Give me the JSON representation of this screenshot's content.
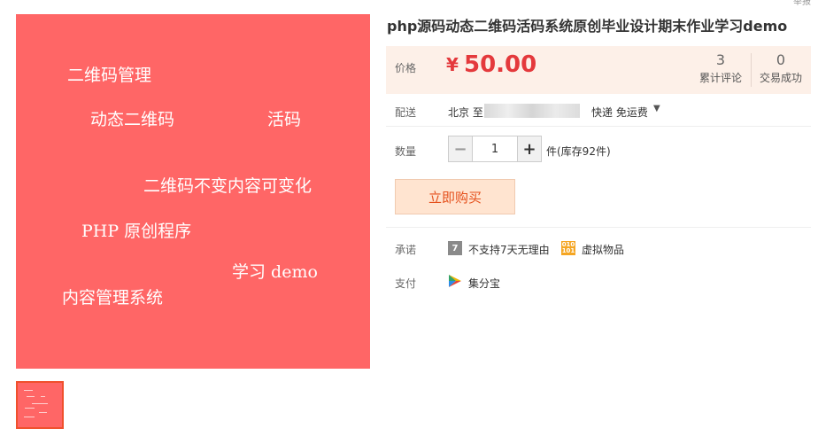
{
  "product": {
    "title": "php源码动态二维码活码系统原创毕业设计期末作业学习demo",
    "image_tags": [
      "二维码管理",
      "动态二维码",
      "活码",
      "二维码不变内容可变化",
      "PHP 原创程序",
      "学习 demo",
      "内容管理系统"
    ],
    "colors": {
      "image_bg": "#ff6666",
      "accent": "#e4393c",
      "buy_text": "#e5511d"
    }
  },
  "price": {
    "label": "价格",
    "currency": "¥",
    "value": "50.00"
  },
  "stats": [
    {
      "num": "3",
      "label": "累计评论"
    },
    {
      "num": "0",
      "label": "交易成功"
    }
  ],
  "shipping": {
    "label": "配送",
    "from": "北京 至",
    "method": "快递 免运费"
  },
  "quantity": {
    "label": "数量",
    "value": "1",
    "stock": "件(库存92件)"
  },
  "buy_button": "立即购买",
  "promise": {
    "label": "承诺",
    "items": [
      {
        "icon": "seven-day-icon",
        "glyph": "7",
        "text": "不支持7天无理由"
      },
      {
        "icon": "virtual-goods-icon",
        "glyph": "010",
        "text": "虚拟物品"
      }
    ]
  },
  "payment": {
    "label": "支付",
    "method": "集分宝"
  },
  "corner_text": "举报"
}
